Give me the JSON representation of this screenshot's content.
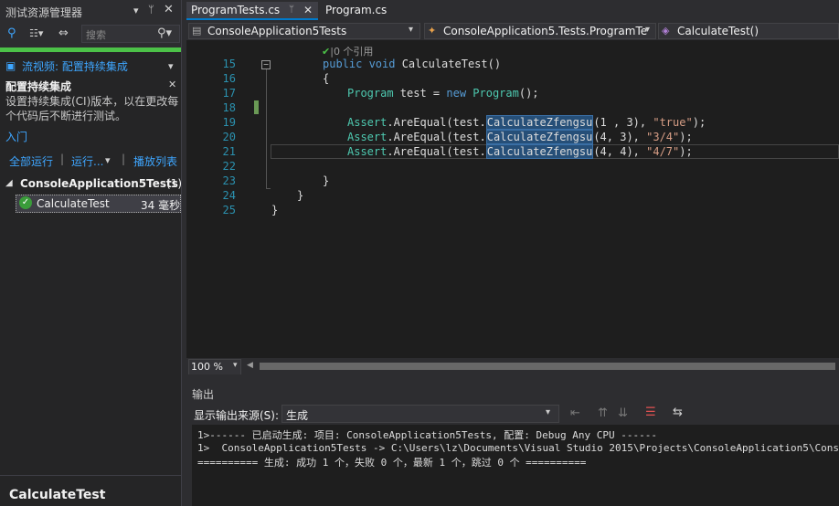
{
  "explorer": {
    "title": "测试资源管理器",
    "search_placeholder": "搜索",
    "video_link": "流视频: 配置持续集成",
    "ci_heading": "配置持续集成",
    "ci_desc_1": "设置持续集成(CI)版本，以在更改每",
    "ci_desc_2": "个代码后不断进行测试。",
    "intro_link": "入门",
    "run_all": "全部运行",
    "run": "运行...",
    "playlist": "播放列表",
    "group_name": "ConsoleApplication5Tests",
    "group_count": "(1)",
    "test_name": "CalculateTest",
    "test_time": "34 毫秒",
    "footer_title": "CalculateTest"
  },
  "tabs": [
    "ProgramTests.cs",
    "Program.cs"
  ],
  "nav": {
    "project": "ConsoleApplication5Tests",
    "class": "ConsoleApplication5.Tests.ProgramTe",
    "member": "CalculateTest()"
  },
  "editor": {
    "codelens": "0 个引用",
    "line_numbers": [
      "15",
      "16",
      "17",
      "18",
      "19",
      "20",
      "21",
      "22",
      "23",
      "24",
      "25"
    ],
    "zoom": "100 %",
    "lines": {
      "l15_kw": "public void ",
      "l15_rest": "CalculateTest()",
      "l16": "{",
      "l17_type": "Program",
      "l17_a": " test = ",
      "l17_new": "new ",
      "l17_type2": "Program",
      "l17_b": "();",
      "assert_type": "Assert",
      "assert_call": ".AreEqual(test.",
      "method": "CalculateZfengsu",
      "l19_args": "(1 , 3), ",
      "l19_str": "\"true\"",
      "l20_args": "(4, 3), ",
      "l20_str": "\"3/4\"",
      "l21_args": "(4, 4), ",
      "l21_str": "\"4/7\"",
      "end": ");",
      "l23": "}",
      "l24": "}",
      "l25": "}"
    }
  },
  "output": {
    "title": "输出",
    "source_label": "显示输出来源(S):",
    "source_value": "生成",
    "lines": [
      "1>------ 已启动生成: 项目: ConsoleApplication5Tests, 配置: Debug Any CPU ------",
      "1>  ConsoleApplication5Tests -> C:\\Users\\lz\\Documents\\Visual Studio 2015\\Projects\\ConsoleApplication5\\ConsoleApplicati",
      "========== 生成: 成功 1 个，失败 0 个，最新 1 个，跳过 0 个 =========="
    ]
  }
}
